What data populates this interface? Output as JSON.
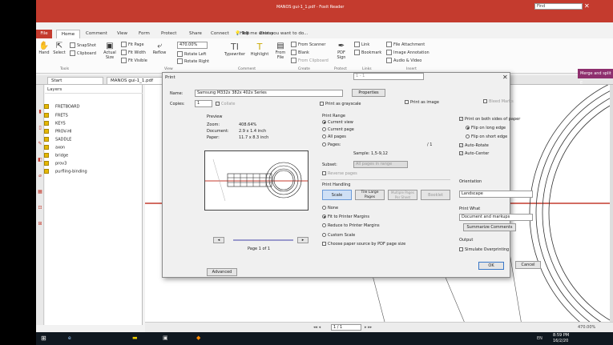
{
  "app": {
    "title": "MANOS gui-1_1.pdf - Foxit Reader",
    "tell_me": "Tell me what you want to do...",
    "find_placeholder": "Find"
  },
  "menu": {
    "file": "File",
    "tabs": [
      "Home",
      "Comment",
      "View",
      "Form",
      "Protect",
      "Share",
      "Connect",
      "Help",
      "Extras"
    ]
  },
  "ribbon": {
    "hand": "Hand",
    "select": "Select",
    "snapshot": "SnapShot",
    "clipboard": "Clipboard",
    "actual_size": "Actual Size",
    "fit_page": "Fit Page",
    "fit_width": "Fit Width",
    "fit_visible": "Fit Visible",
    "reflow": "Reflow",
    "zoom": "470.00%",
    "rotate_left": "Rotate Left",
    "rotate_right": "Rotate Right",
    "typewriter": "Typewriter",
    "highlight": "Highlight",
    "from_file": "From File",
    "from_scanner": "From Scanner",
    "blank": "Blank",
    "from_clipboard": "From Clipboard",
    "pdf_sign": "PDF Sign",
    "link": "Link",
    "bookmark": "Bookmark",
    "file_attachment": "File Attachment",
    "image_annotation": "Image Annotation",
    "audio_video": "Audio & Video",
    "groups": [
      "Tools",
      "View",
      "Comment",
      "Create",
      "Protect",
      "Links",
      "Insert"
    ]
  },
  "doc_tabs": [
    "Start",
    "MANOS gui-1_1.pdf"
  ],
  "merge_button": "Merge and split E",
  "layers": {
    "title": "Layers",
    "items": [
      "FRETBOARD",
      "FRETS",
      "KEYS",
      "PROV-HI",
      "SADDLE",
      "axon",
      "bridge",
      "prov3",
      "purfling-binding"
    ]
  },
  "status": {
    "page": "1 / 1",
    "zoom": "470.00%"
  },
  "taskbar": {
    "time": "8:59 PM",
    "date": "16/2/20",
    "lang": "EN"
  },
  "print": {
    "title": "Print",
    "name_label": "Name:",
    "printer": "Samsung M332x 382x 402x Series",
    "properties": "Properties",
    "copies_label": "Copies:",
    "copies": "1",
    "collate": "Collate",
    "print_grayscale": "Print as grayscale",
    "print_image": "Print as image",
    "bleed_marks": "Bleed Marks",
    "preview": {
      "title": "Preview",
      "zoom_label": "Zoom:",
      "zoom": "408.64%",
      "document_label": "Document:",
      "document": "2.9 x 1.4 inch",
      "paper_label": "Paper:",
      "paper": "11.7 x 8.3 inch",
      "page_of": "Page 1 of 1"
    },
    "range": {
      "title": "Print Range",
      "current_view": "Current view",
      "current_page": "Current page",
      "all_pages": "All pages",
      "pages": "Pages:",
      "pages_value": "1 - 1",
      "pages_total": "/ 1",
      "sample": "Sample: 1,5-9,12",
      "subset_label": "Subset:",
      "subset": "All pages in range",
      "reverse": "Reverse pages"
    },
    "handling": {
      "title": "Print Handling",
      "scale": "Scale",
      "tile": "Tile Large Pages",
      "multiple": "Multiple Pages Per Sheet",
      "booklet": "Booklet",
      "none": "None",
      "fit": "Fit to Printer Margins",
      "reduce": "Reduce to Printer Margins",
      "custom": "Custom Scale",
      "choose_source": "Choose paper source by PDF page size"
    },
    "duplex": {
      "both_sides": "Print on both sides of paper",
      "long_edge": "Flip on long edge",
      "short_edge": "Flip on short edge",
      "auto_rotate": "Auto-Rotate",
      "auto_center": "Auto-Center"
    },
    "orientation_label": "Orientation",
    "orientation": "Landscape",
    "what_label": "Print What",
    "what": "Document and markups",
    "summarize": "Summarize Comments",
    "output_label": "Output",
    "simulate": "Simulate Overprinting",
    "advanced": "Advanced",
    "ok": "OK",
    "cancel": "Cancel"
  },
  "colors": {
    "brand": "#c43b2e",
    "merge": "#8e2f6e",
    "layer_check": "#e6b800"
  }
}
